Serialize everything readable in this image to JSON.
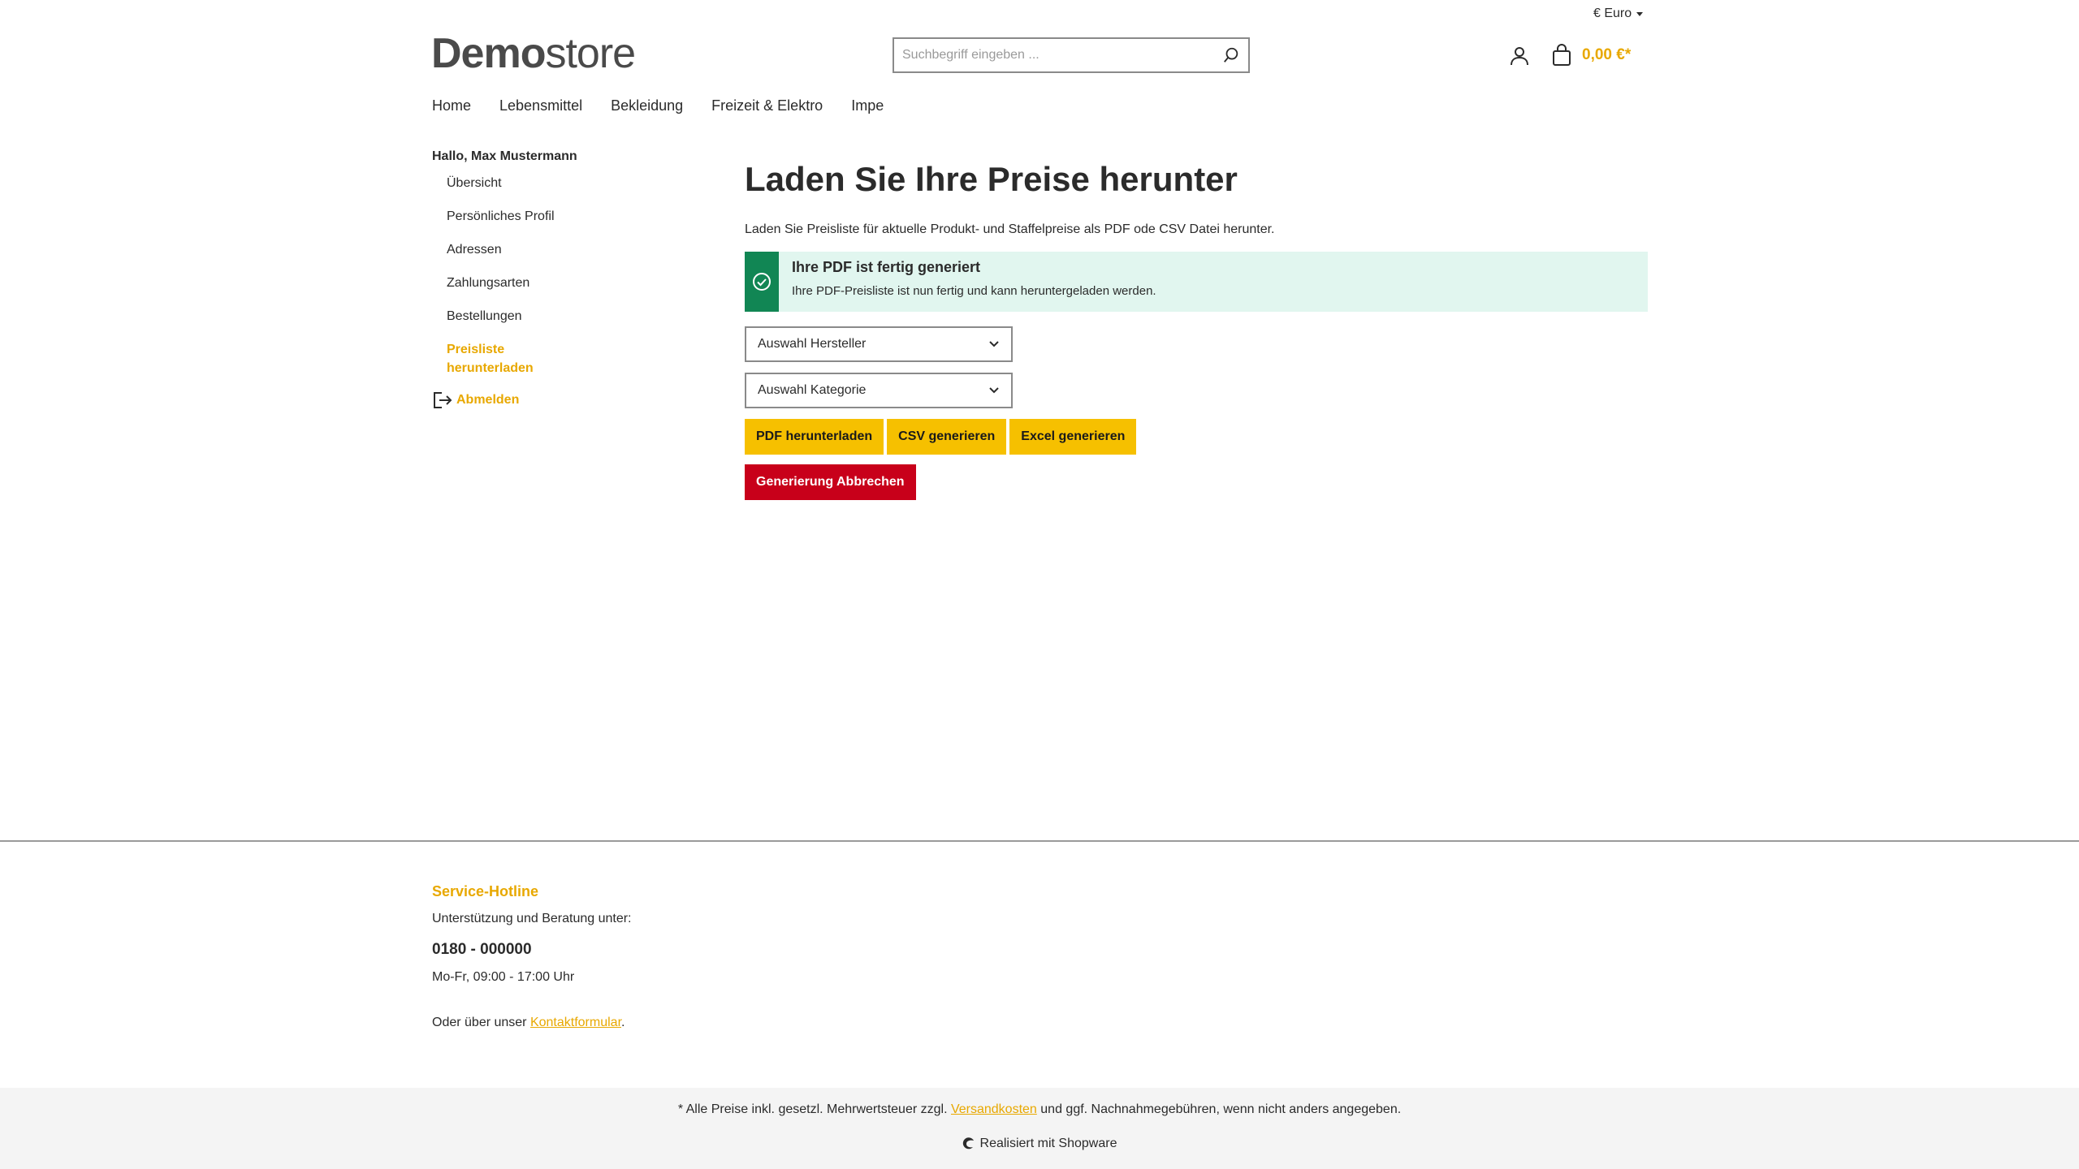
{
  "header": {
    "currency": "€ Euro",
    "logo": {
      "bold": "Demo",
      "light": "store"
    },
    "search_placeholder": "Suchbegriff eingeben ...",
    "cart_amount": "0,00 €*"
  },
  "nav": [
    "Home",
    "Lebensmittel",
    "Bekleidung",
    "Freizeit & Elektro",
    "Impe"
  ],
  "sidebar": {
    "greeting": "Hallo, Max Mustermann",
    "items": [
      "Übersicht",
      "Persönliches Profil",
      "Adressen",
      "Zahlungsarten",
      "Bestellungen",
      "Preisliste herunterladen"
    ],
    "logout": "Abmelden"
  },
  "main": {
    "title": "Laden Sie Ihre Preise herunter",
    "intro": "Laden Sie Preisliste für aktuelle Produkt- und Staffelpreise als PDF ode CSV Datei herunter.",
    "alert": {
      "title": "Ihre PDF ist fertig generiert",
      "text": "Ihre PDF-Preisliste ist nun fertig und kann heruntergeladen werden."
    },
    "select_manufacturer": "Auswahl Hersteller",
    "select_category": "Auswahl Kategorie",
    "btn_pdf": "PDF herunterladen",
    "btn_csv": "CSV generieren",
    "btn_excel": "Excel generieren",
    "btn_cancel": "Generierung Abbrechen"
  },
  "footer": {
    "hotline_title": "Service-Hotline",
    "support_text": "Unterstützung und Beratung unter:",
    "phone": "0180 - 000000",
    "hours": "Mo-Fr, 09:00 - 17:00 Uhr",
    "contact_prefix": "Oder über unser ",
    "contact_link": "Kontaktformular",
    "contact_suffix": "."
  },
  "bottom": {
    "legal_prefix": "* Alle Preise inkl. gesetzl. Mehrwertsteuer zzgl. ",
    "legal_link": "Versandkosten",
    "legal_suffix": " und ggf. Nachnahmegebühren, wenn nicht anders angegeben.",
    "powered": "Realisiert mit Shopware"
  },
  "colors": {
    "accent": "#e8a800",
    "button_yellow": "#f6c000",
    "danger": "#c8001a",
    "success": "#118654",
    "success_bg": "#e1f6ef"
  },
  "icons": [
    "search-icon",
    "user-icon",
    "cart-icon",
    "check-circle-icon",
    "chevron-down-icon",
    "logout-icon",
    "shopware-icon"
  ]
}
